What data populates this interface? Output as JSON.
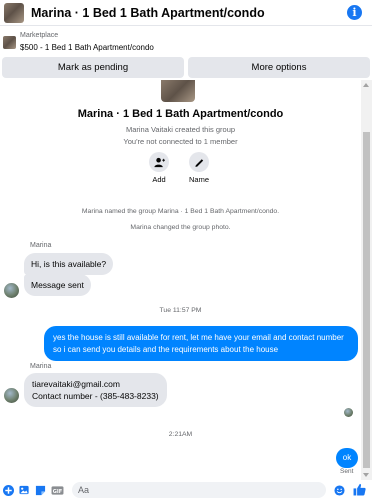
{
  "header": {
    "title": "Marina · 1 Bed 1 Bath Apartment/condo",
    "info_icon": "info-icon"
  },
  "marketplace": {
    "label": "Marketplace",
    "listing": "$500 - 1 Bed 1 Bath Apartment/condo"
  },
  "actions": {
    "mark_pending": "Mark as pending",
    "more_options": "More options"
  },
  "group": {
    "name": "Marina · 1 Bed 1 Bath Apartment/condo",
    "created": "Marina Vaitaki created this group",
    "connected": "You're not connected to 1 member",
    "add_label": "Add",
    "name_label": "Name"
  },
  "system": {
    "renamed": "Marina named the group Marina · 1 Bed 1 Bath Apartment/condo.",
    "photo": "Marina changed the group photo."
  },
  "messages": {
    "sender1": "Marina",
    "msg1": "Hi, is this available?",
    "msg2": "Message sent",
    "time1": "Tue 11:57 PM",
    "out1": "yes the house is still available for rent, let me have your email  and contact number so i can send you details and the requirements about the house",
    "sender2": "Marina",
    "msg3_line1": "tiarevaitaki@gmail.com",
    "msg3_line2": "Contact number - (385-483-8233)",
    "time2": "2:21AM",
    "out2": "ok",
    "status": "Sent"
  },
  "composer": {
    "placeholder": "Aa",
    "accent": "#1877f2"
  },
  "colors": {
    "outgoing": "#0084ff",
    "incoming": "#e4e6eb",
    "button": "#e4e6eb"
  }
}
